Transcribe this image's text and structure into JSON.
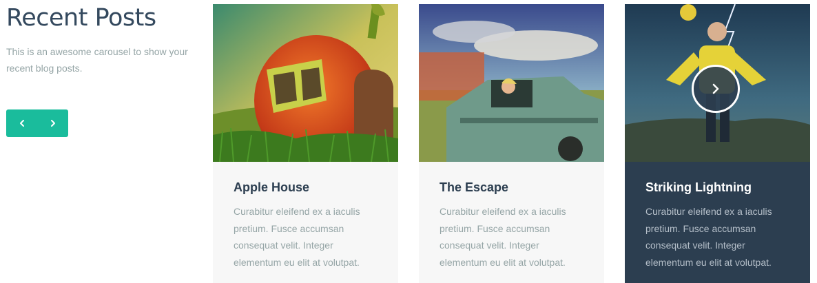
{
  "section": {
    "title": "Recent Posts",
    "description": "This is an awesome carousel to show your recent blog posts."
  },
  "nav": {
    "prev_icon": "chevron-left-icon",
    "next_icon": "chevron-right-icon",
    "accent": "#1abc9c"
  },
  "posts": [
    {
      "title": "Apple House",
      "excerpt": "Curabitur eleifend ex a iaculis pretium. Fusce accumsan consequat velit. Integer elementum eu elit at volutpat."
    },
    {
      "title": "The Escape",
      "excerpt": "Curabitur eleifend ex a iaculis pretium. Fusce accumsan consequat velit. Integer elementum eu elit at volutpat."
    },
    {
      "title": "Striking Lightning",
      "excerpt": "Curabitur eleifend ex a iaculis pretium. Fusce accumsan consequat velit. Integer elementum eu elit at volutpat."
    }
  ],
  "colors": {
    "heading": "#34495e",
    "muted": "#95a5a6",
    "dark_card": "#2c3e50",
    "light_card": "#f7f7f7"
  }
}
